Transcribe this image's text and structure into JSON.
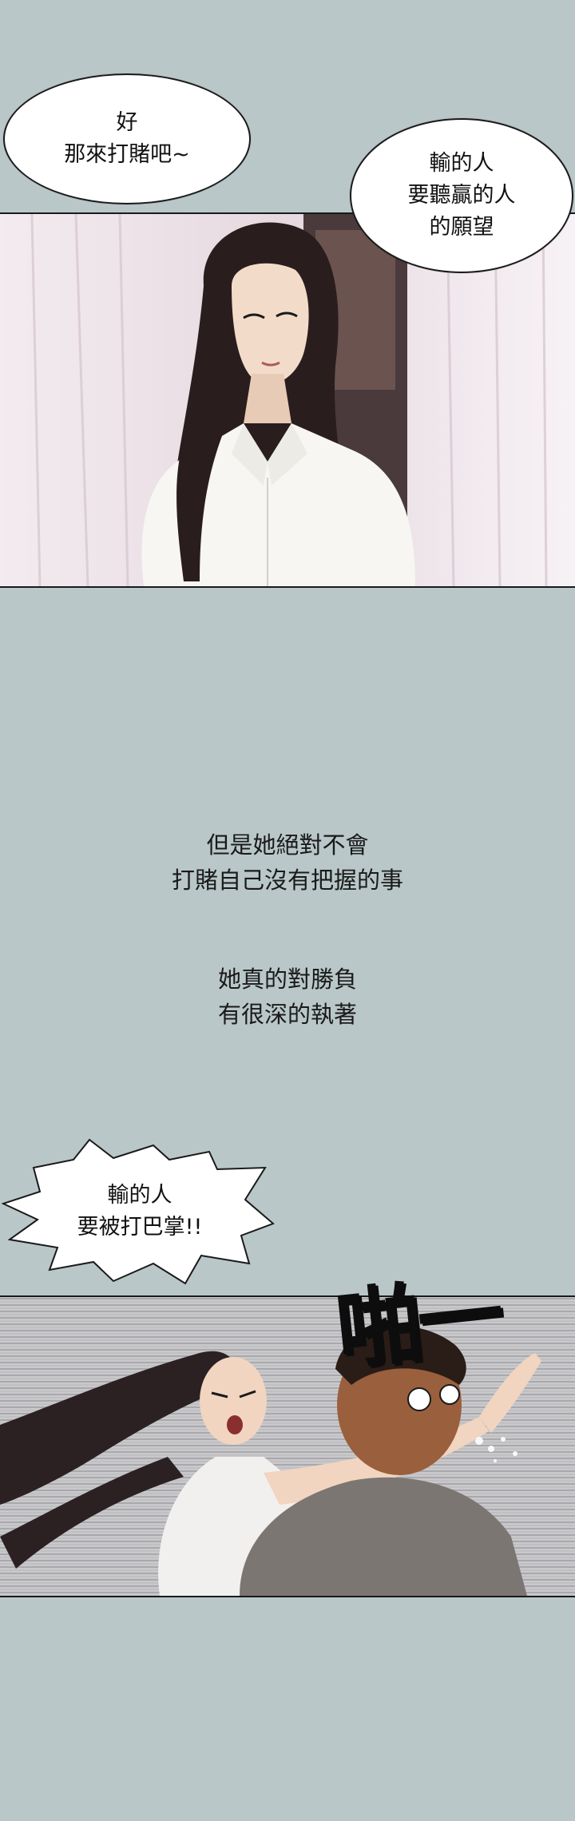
{
  "bubbles": {
    "top_left": "好\n那來打賭吧~",
    "top_right": "輸的人\n要聽贏的人\n的願望",
    "slap_warning": "輸的人\n要被打巴掌!!"
  },
  "narration": {
    "line_group_1": "但是她絕對不會\n打賭自己沒有把握的事",
    "line_group_2": "她真的對勝負\n有很深的執著"
  },
  "sound_effect": "啪一",
  "colors": {
    "background": "#b9c7c8",
    "panel_border": "#1a1a1a",
    "bubble_fill": "#ffffff"
  }
}
